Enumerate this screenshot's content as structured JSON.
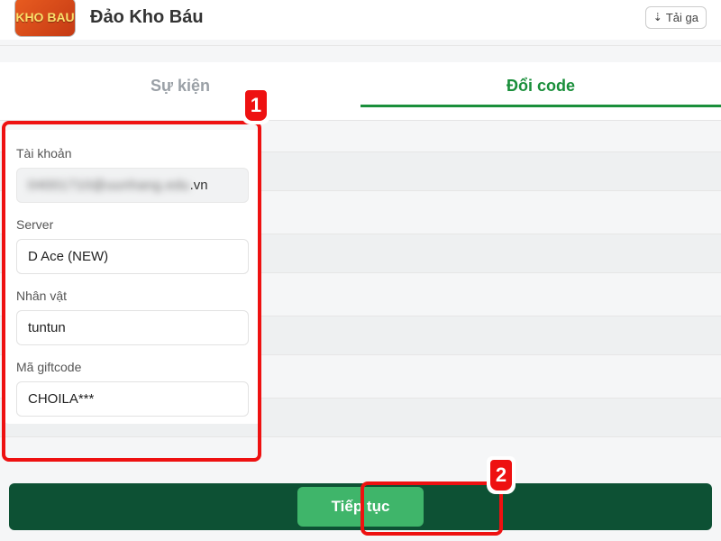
{
  "header": {
    "app_icon_text": "KHO BAU",
    "title": "Đảo Kho Báu",
    "download_label": "Tải ga"
  },
  "tabs": {
    "event": "Sự kiện",
    "redeem": "Đổi code"
  },
  "form": {
    "account_label": "Tài khoản",
    "account_value_blurred": "04001710@uunhang.edu",
    "account_suffix": ".vn",
    "server_label": "Server",
    "server_value": "D Ace (NEW)",
    "character_label": "Nhân vật",
    "character_value": "tuntun",
    "giftcode_label": "Mã giftcode",
    "giftcode_value": "CHOILA***"
  },
  "cta": {
    "continue": "Tiếp tục"
  },
  "steps": {
    "one": "1",
    "two": "2"
  }
}
